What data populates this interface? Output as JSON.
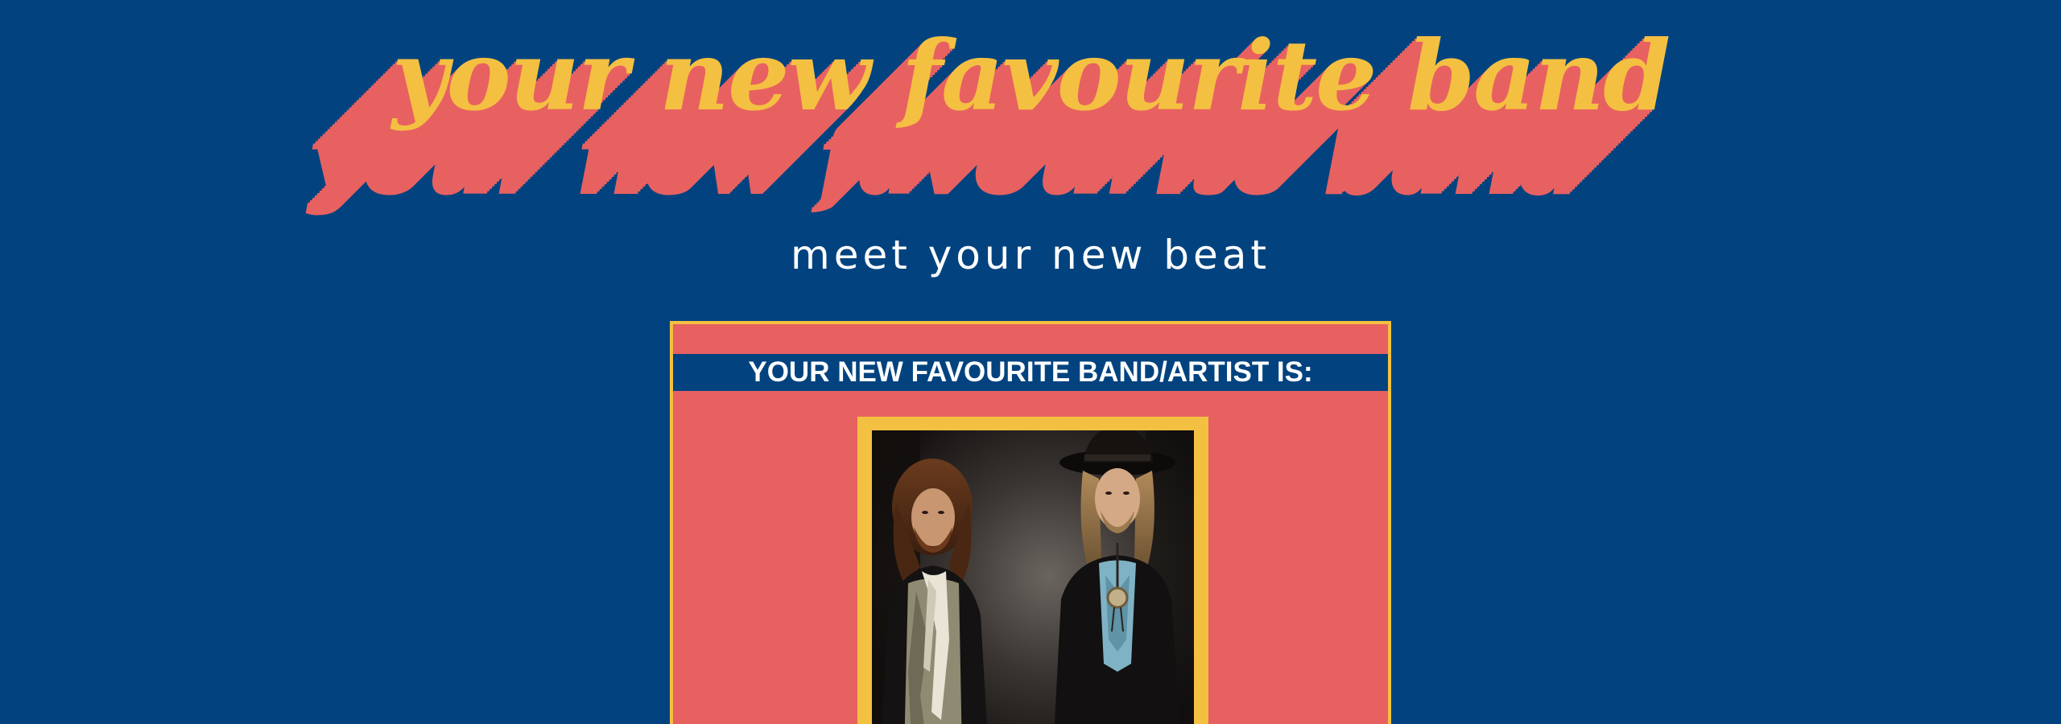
{
  "hero": {
    "title": "your new favourite band",
    "subtitle": "meet your new beat"
  },
  "card": {
    "heading": "YOUR NEW FAVOURITE BAND/ARTIST IS:",
    "photo": {
      "description": "band-photo"
    }
  },
  "colors": {
    "background": "#02437f",
    "accent_yellow": "#f4c041",
    "accent_coral": "#e86161",
    "text_white": "#ffffff"
  }
}
